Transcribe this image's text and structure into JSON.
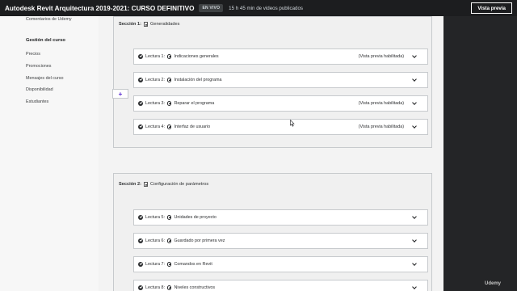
{
  "header": {
    "course_title": "Autodesk Revit Arquitectura 2019-2021: CURSO DEFINITIVO",
    "live_badge": "EN VIVO",
    "video_info": "15 h 45 min de videos publicados",
    "preview_button": "Vista previa"
  },
  "sidebar": {
    "top_item": "Comentarios de Udemy",
    "heading": "Gestión del curso",
    "items": [
      "Precios",
      "Promociones",
      "Mensajes del curso",
      "Disponibilidad",
      "Estudiantes"
    ]
  },
  "sections": [
    {
      "label": "Sección 1:",
      "title": "Generalidades",
      "lectures": [
        {
          "label": "Lectura 1:",
          "title": "Indicaciones generales",
          "preview": "(Vista previa habilitada)"
        },
        {
          "label": "Lectura 2:",
          "title": "Instalación del programa",
          "preview": ""
        },
        {
          "label": "Lectura 3:",
          "title": "Reparar el programa",
          "preview": "(Vista previa habilitada)"
        },
        {
          "label": "Lectura 4:",
          "title": "Interfaz de usuario",
          "preview": "(Vista previa habilitada)"
        }
      ]
    },
    {
      "label": "Sección 2:",
      "title": "Configuración de parámetros",
      "lectures": [
        {
          "label": "Lectura 5:",
          "title": "Unidades de proyecto",
          "preview": ""
        },
        {
          "label": "Lectura 6:",
          "title": "Guardado por primera vez",
          "preview": ""
        },
        {
          "label": "Lectura 7:",
          "title": "Comandos en Revit",
          "preview": ""
        },
        {
          "label": "Lectura 8:",
          "title": "Niveles constructivos",
          "preview": ""
        }
      ]
    }
  ],
  "add_button": "+",
  "watermark": "Udemy",
  "icons": [
    "check-circle-icon",
    "plus-circle-icon",
    "chevron-down-icon",
    "document-icon",
    "plus-icon"
  ]
}
